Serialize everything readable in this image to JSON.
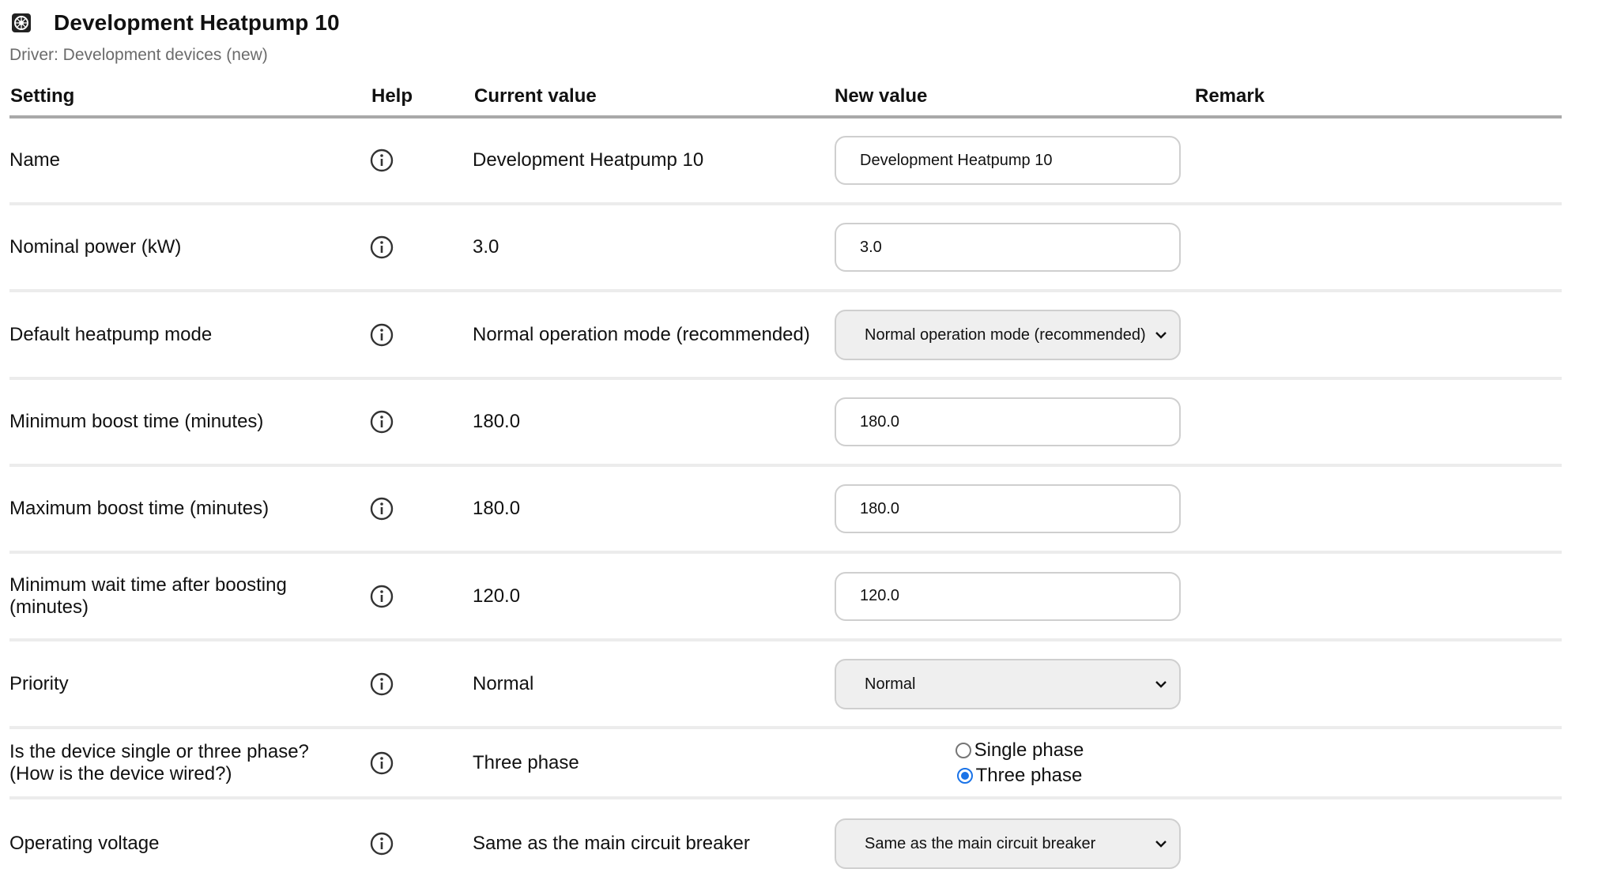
{
  "header": {
    "icon": "device-icon",
    "title": "Development Heatpump 10",
    "driver": "Driver: Development devices (new)"
  },
  "table": {
    "columns": [
      "Setting",
      "Help",
      "Current value",
      "New value",
      "Remark"
    ],
    "rows": [
      {
        "setting": "Name",
        "current": "Development Heatpump 10",
        "new_value": "Development Heatpump 10",
        "control": "text"
      },
      {
        "setting": "Nominal power (kW)",
        "current": "3.0",
        "new_value": "3.0",
        "control": "text"
      },
      {
        "setting": "Default heatpump mode",
        "current": "Normal operation mode (recommended)",
        "new_value": "Normal operation mode (recommended)",
        "control": "select"
      },
      {
        "setting": "Minimum boost time (minutes)",
        "current": "180.0",
        "new_value": "180.0",
        "control": "text"
      },
      {
        "setting": "Maximum boost time (minutes)",
        "current": "180.0",
        "new_value": "180.0",
        "control": "text"
      },
      {
        "setting": "Minimum wait time after boosting (minutes)",
        "current": "120.0",
        "new_value": "120.0",
        "control": "text"
      },
      {
        "setting": "Priority",
        "current": "Normal",
        "new_value": "Normal",
        "control": "select"
      },
      {
        "setting": "Is the device single or three phase? (How is the device wired?)",
        "current": "Three phase",
        "control": "radio",
        "options": [
          {
            "label": "Single phase",
            "checked": false
          },
          {
            "label": "Three phase",
            "checked": true
          }
        ]
      },
      {
        "setting": "Operating voltage",
        "current": "Same as the main circuit breaker",
        "new_value": "Same as the main circuit breaker",
        "control": "select"
      }
    ]
  },
  "icons": {
    "help": "info-icon",
    "dropdown": "chevron-down-icon"
  },
  "colors": {
    "radio_checked": "#1a73e8",
    "header_rule": "#a9a9a9",
    "row_rule": "#ececec",
    "select_bg": "#efefef"
  }
}
